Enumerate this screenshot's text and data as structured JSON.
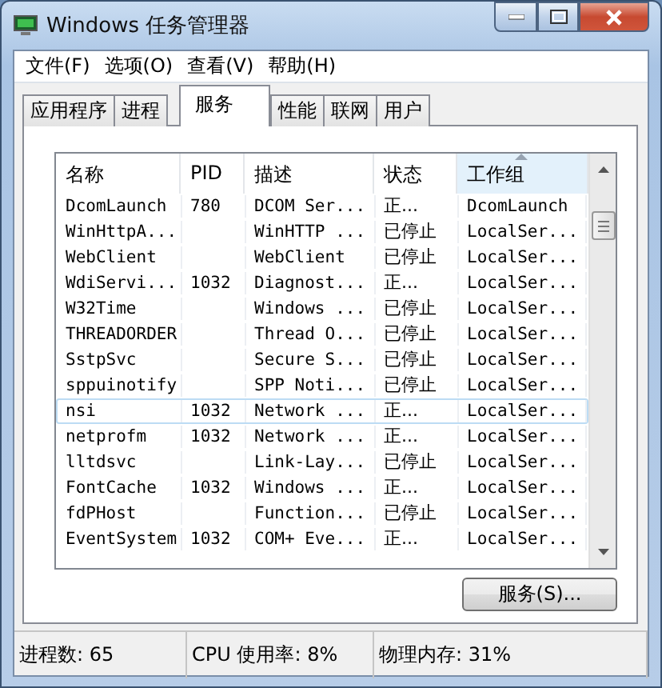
{
  "window": {
    "title": "Windows 任务管理器"
  },
  "menu": [
    "文件(F)",
    "选项(O)",
    "查看(V)",
    "帮助(H)"
  ],
  "tabs": [
    {
      "label": "应用程序",
      "selected": false
    },
    {
      "label": "进程",
      "selected": false
    },
    {
      "label": "服务",
      "selected": true
    },
    {
      "label": "性能",
      "selected": false
    },
    {
      "label": "联网",
      "selected": false
    },
    {
      "label": "用户",
      "selected": false
    }
  ],
  "table": {
    "columns": [
      {
        "label": "名称",
        "sorted": false
      },
      {
        "label": "PID",
        "sorted": false
      },
      {
        "label": "描述",
        "sorted": false
      },
      {
        "label": "状态",
        "sorted": false
      },
      {
        "label": "工作组",
        "sorted": true
      }
    ],
    "rows": [
      {
        "cells": [
          "DcomLaunch",
          "780",
          "DCOM Ser...",
          "正...",
          "DcomLaunch"
        ],
        "selected": false
      },
      {
        "cells": [
          "WinHttpA...",
          "",
          "WinHTTP ...",
          "已停止",
          "LocalSer..."
        ],
        "selected": false
      },
      {
        "cells": [
          "WebClient",
          "",
          "WebClient",
          "已停止",
          "LocalSer..."
        ],
        "selected": false
      },
      {
        "cells": [
          "WdiServi...",
          "1032",
          "Diagnost...",
          "正...",
          "LocalSer..."
        ],
        "selected": false
      },
      {
        "cells": [
          "W32Time",
          "",
          "Windows ...",
          "已停止",
          "LocalSer..."
        ],
        "selected": false
      },
      {
        "cells": [
          "THREADORDER",
          "",
          "Thread O...",
          "已停止",
          "LocalSer..."
        ],
        "selected": false
      },
      {
        "cells": [
          "SstpSvc",
          "",
          "Secure S...",
          "已停止",
          "LocalSer..."
        ],
        "selected": false
      },
      {
        "cells": [
          "sppuinotify",
          "",
          "SPP Noti...",
          "已停止",
          "LocalSer..."
        ],
        "selected": false
      },
      {
        "cells": [
          "nsi",
          "1032",
          "Network ...",
          "正...",
          "LocalSer..."
        ],
        "selected": true
      },
      {
        "cells": [
          "netprofm",
          "1032",
          "Network ...",
          "正...",
          "LocalSer..."
        ],
        "selected": false
      },
      {
        "cells": [
          "lltdsvc",
          "",
          "Link-Lay...",
          "已停止",
          "LocalSer..."
        ],
        "selected": false
      },
      {
        "cells": [
          "FontCache",
          "1032",
          "Windows ...",
          "正...",
          "LocalSer..."
        ],
        "selected": false
      },
      {
        "cells": [
          "fdPHost",
          "",
          "Function...",
          "已停止",
          "LocalSer..."
        ],
        "selected": false
      },
      {
        "cells": [
          "EventSystem",
          "1032",
          "COM+ Eve...",
          "正...",
          "LocalSer..."
        ],
        "selected": false
      }
    ]
  },
  "services_button": "服务(S)...",
  "status_bar": [
    "进程数: 65",
    "CPU 使用率: 8%",
    "物理内存: 31%"
  ]
}
